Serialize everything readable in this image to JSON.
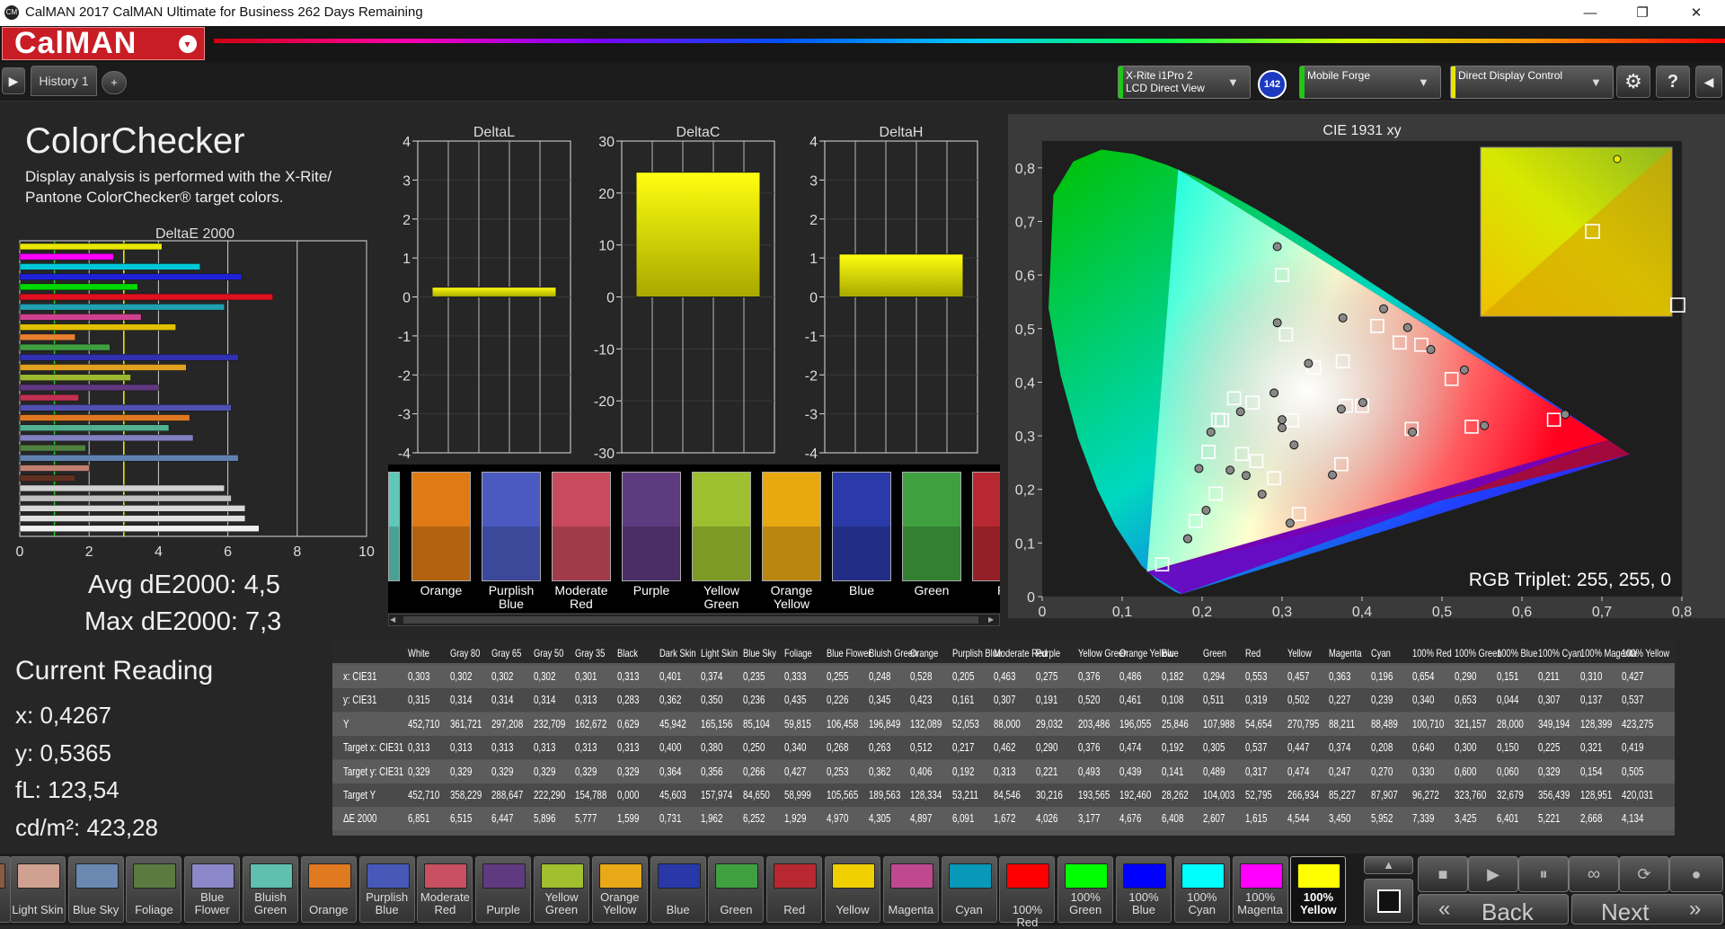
{
  "window": {
    "title": "CalMAN 2017 CalMAN Ultimate for Business 262 Days Remaining",
    "icon": "CM",
    "minimize": "—",
    "restore": "❐",
    "close": "✕"
  },
  "app": {
    "logo": "CalMAN",
    "logo_menu": "▾"
  },
  "toolbar": {
    "history_tab": "History 1",
    "add_tab": "+",
    "play": "▶",
    "devices": [
      {
        "line1": "X-Rite i1Pro 2",
        "line2": "LCD Direct View",
        "accent": "#1ec814"
      },
      {
        "line1": "Mobile Forge",
        "line2": "",
        "accent": "#1ec814"
      },
      {
        "line1": "Direct Display Control",
        "line2": "",
        "accent": "#e6e600"
      }
    ],
    "badge": "142",
    "settings": "⚙",
    "help": "?",
    "collapse": "◀"
  },
  "colors": {
    "accent": "#c81d25",
    "bar_yellow": "#ffff00"
  },
  "page": {
    "title": "ColorChecker",
    "subtitle_line1": "Display analysis is performed with the X-Rite/",
    "subtitle_line2": "Pantone ColorChecker® target colors.",
    "avg": "Avg dE2000: 4,5",
    "max": "Max dE2000: 7,3"
  },
  "current": {
    "title": "Current Reading",
    "x": "x: 0,4267",
    "y": "y: 0,5365",
    "fl": "fL: 123,54",
    "cdm2": "cd/m²: 423,28"
  },
  "chart_data": [
    {
      "type": "bar",
      "orientation": "horizontal",
      "title": "DeltaE 2000",
      "xlim": [
        0,
        10
      ],
      "xticks": [
        "0",
        "2",
        "4",
        "6",
        "8",
        "10"
      ],
      "reference_lines": [
        1,
        3
      ],
      "bars": [
        {
          "value": 4.1,
          "color": "#e8e800"
        },
        {
          "value": 2.7,
          "color": "#ff00ff"
        },
        {
          "value": 5.2,
          "color": "#00c8d8"
        },
        {
          "value": 6.4,
          "color": "#2020d8"
        },
        {
          "value": 3.4,
          "color": "#00d800"
        },
        {
          "value": 7.3,
          "color": "#e01020"
        },
        {
          "value": 5.9,
          "color": "#20a0b0"
        },
        {
          "value": 3.5,
          "color": "#d04090"
        },
        {
          "value": 4.5,
          "color": "#e0c000"
        },
        {
          "value": 1.6,
          "color": "#e88030"
        },
        {
          "value": 2.6,
          "color": "#40a040"
        },
        {
          "value": 6.3,
          "color": "#3030b0"
        },
        {
          "value": 4.8,
          "color": "#e0a020"
        },
        {
          "value": 3.2,
          "color": "#9ab830"
        },
        {
          "value": 4.0,
          "color": "#603880"
        },
        {
          "value": 1.7,
          "color": "#c03050"
        },
        {
          "value": 6.1,
          "color": "#5050b0"
        },
        {
          "value": 4.9,
          "color": "#e07820"
        },
        {
          "value": 4.3,
          "color": "#50b090"
        },
        {
          "value": 5.0,
          "color": "#8080c0"
        },
        {
          "value": 1.9,
          "color": "#508040"
        },
        {
          "value": 6.3,
          "color": "#6080b0"
        },
        {
          "value": 2.0,
          "color": "#c08070"
        },
        {
          "value": 1.6,
          "color": "#603020"
        },
        {
          "value": 5.9,
          "color": "#d0d0d0"
        },
        {
          "value": 6.1,
          "color": "#c0c0c0"
        },
        {
          "value": 6.5,
          "color": "#d8d8d8"
        },
        {
          "value": 6.5,
          "color": "#e0e0e0"
        },
        {
          "value": 6.9,
          "color": "#f0f0f0"
        }
      ]
    },
    {
      "type": "bar",
      "title": "DeltaL",
      "ylim": [
        -4,
        4
      ],
      "yticks": [
        "4",
        "3",
        "2",
        "1",
        "0",
        "-1",
        "-2",
        "-3",
        "-4"
      ],
      "value": 0.25
    },
    {
      "type": "bar",
      "title": "DeltaC",
      "ylim": [
        -30,
        30
      ],
      "yticks": [
        "30",
        "20",
        "10",
        "0",
        "-10",
        "-20",
        "-30"
      ],
      "value": 24
    },
    {
      "type": "bar",
      "title": "DeltaH",
      "ylim": [
        -4,
        4
      ],
      "yticks": [
        "4",
        "3",
        "2",
        "1",
        "0",
        "-1",
        "-2",
        "-3",
        "-4"
      ],
      "value": 1.1
    },
    {
      "type": "scatter",
      "title": "CIE 1931 xy",
      "xlim": [
        0,
        0.8
      ],
      "ylim": [
        0,
        0.85
      ],
      "xticks": [
        "0",
        "0,1",
        "0,2",
        "0,3",
        "0,4",
        "0,5",
        "0,6",
        "0,7",
        "0,8"
      ],
      "yticks": [
        "0",
        "0,1",
        "0,2",
        "0,3",
        "0,4",
        "0,5",
        "0,6",
        "0,7",
        "0,8"
      ],
      "gamut": {
        "r": [
          0.708,
          0.292
        ],
        "g": [
          0.17,
          0.797
        ],
        "b": [
          0.131,
          0.046
        ]
      },
      "targets": [
        [
          0.64,
          0.33
        ],
        [
          0.3,
          0.6
        ],
        [
          0.15,
          0.06
        ],
        [
          0.3127,
          0.329
        ],
        [
          0.419,
          0.505
        ],
        [
          0.225,
          0.329
        ],
        [
          0.321,
          0.154
        ],
        [
          0.4,
          0.356
        ],
        [
          0.38,
          0.356
        ],
        [
          0.25,
          0.266
        ],
        [
          0.34,
          0.427
        ],
        [
          0.268,
          0.253
        ],
        [
          0.263,
          0.362
        ],
        [
          0.512,
          0.406
        ],
        [
          0.217,
          0.192
        ],
        [
          0.462,
          0.313
        ],
        [
          0.29,
          0.221
        ],
        [
          0.376,
          0.439
        ],
        [
          0.474,
          0.47
        ],
        [
          0.192,
          0.141
        ],
        [
          0.305,
          0.489
        ],
        [
          0.537,
          0.317
        ],
        [
          0.447,
          0.474
        ],
        [
          0.374,
          0.247
        ],
        [
          0.208,
          0.27
        ],
        [
          0.22,
          0.33
        ],
        [
          0.24,
          0.37
        ]
      ],
      "measured": [
        [
          0.654,
          0.34
        ],
        [
          0.294,
          0.653
        ],
        [
          0.182,
          0.108
        ],
        [
          0.3,
          0.315
        ],
        [
          0.427,
          0.537
        ],
        [
          0.211,
          0.307
        ],
        [
          0.31,
          0.137
        ],
        [
          0.401,
          0.362
        ],
        [
          0.374,
          0.35
        ],
        [
          0.235,
          0.236
        ],
        [
          0.333,
          0.435
        ],
        [
          0.255,
          0.226
        ],
        [
          0.248,
          0.345
        ],
        [
          0.528,
          0.423
        ],
        [
          0.205,
          0.161
        ],
        [
          0.463,
          0.307
        ],
        [
          0.275,
          0.191
        ],
        [
          0.376,
          0.52
        ],
        [
          0.486,
          0.461
        ],
        [
          0.182,
          0.108
        ],
        [
          0.294,
          0.511
        ],
        [
          0.553,
          0.319
        ],
        [
          0.457,
          0.502
        ],
        [
          0.363,
          0.227
        ],
        [
          0.196,
          0.239
        ],
        [
          0.29,
          0.38
        ],
        [
          0.3,
          0.33
        ],
        [
          0.315,
          0.283
        ]
      ],
      "current": [
        0.4267,
        0.5365
      ],
      "rgb_triplet": "RGB Triplet: 255, 255, 0"
    }
  ],
  "swatches": [
    {
      "label": "",
      "color": "#5fc8b8"
    },
    {
      "label": "Orange",
      "color": "#e07a14"
    },
    {
      "label": "Purplish\nBlue",
      "color": "#4b5ac0"
    },
    {
      "label": "Moderate\nRed",
      "color": "#c84a5c"
    },
    {
      "label": "Purple",
      "color": "#5e3a7e"
    },
    {
      "label": "Yellow\nGreen",
      "color": "#9cc030"
    },
    {
      "label": "Orange\nYellow",
      "color": "#e8a810"
    },
    {
      "label": "Blue",
      "color": "#2a3aa8"
    },
    {
      "label": "Green",
      "color": "#40a040"
    },
    {
      "label": "R",
      "color": "#b82830"
    }
  ],
  "table": {
    "headers": [
      "White",
      "Gray 80",
      "Gray 65",
      "Gray 50",
      "Gray 35",
      "Black",
      "Dark Skin",
      "Light Skin",
      "Blue Sky",
      "Foliage",
      "Blue Flower",
      "Bluish Green",
      "Orange",
      "Purplish Blue",
      "Moderate Red",
      "Purple",
      "Yellow Green",
      "Orange Yellow",
      "Blue",
      "Green",
      "Red",
      "Yellow",
      "Magenta",
      "Cyan",
      "100% Red",
      "100% Green",
      "100% Blue",
      "100% Cyan",
      "100% Magenta",
      "100% Yellow"
    ],
    "rows": [
      {
        "label": "x: CIE31",
        "values": [
          "0,303",
          "0,302",
          "0,302",
          "0,302",
          "0,301",
          "0,313",
          "0,401",
          "0,374",
          "0,235",
          "0,333",
          "0,255",
          "0,248",
          "0,528",
          "0,205",
          "0,463",
          "0,275",
          "0,376",
          "0,486",
          "0,182",
          "0,294",
          "0,553",
          "0,457",
          "0,363",
          "0,196",
          "0,654",
          "0,290",
          "0,151",
          "0,211",
          "0,310",
          "0,427"
        ]
      },
      {
        "label": "y: CIE31",
        "values": [
          "0,315",
          "0,314",
          "0,314",
          "0,314",
          "0,313",
          "0,283",
          "0,362",
          "0,350",
          "0,236",
          "0,435",
          "0,226",
          "0,345",
          "0,423",
          "0,161",
          "0,307",
          "0,191",
          "0,520",
          "0,461",
          "0,108",
          "0,511",
          "0,319",
          "0,502",
          "0,227",
          "0,239",
          "0,340",
          "0,653",
          "0,044",
          "0,307",
          "0,137",
          "0,537"
        ]
      },
      {
        "label": "Y",
        "values": [
          "452,710",
          "361,721",
          "297,208",
          "232,709",
          "162,672",
          "0,629",
          "45,942",
          "165,156",
          "85,104",
          "59,815",
          "106,458",
          "196,849",
          "132,089",
          "52,053",
          "88,000",
          "29,032",
          "203,486",
          "196,055",
          "25,846",
          "107,988",
          "54,654",
          "270,795",
          "88,211",
          "88,489",
          "100,710",
          "321,157",
          "28,000",
          "349,194",
          "128,399",
          "423,275"
        ]
      },
      {
        "label": "Target x: CIE31",
        "values": [
          "0,313",
          "0,313",
          "0,313",
          "0,313",
          "0,313",
          "0,313",
          "0,400",
          "0,380",
          "0,250",
          "0,340",
          "0,268",
          "0,263",
          "0,512",
          "0,217",
          "0,462",
          "0,290",
          "0,376",
          "0,474",
          "0,192",
          "0,305",
          "0,537",
          "0,447",
          "0,374",
          "0,208",
          "0,640",
          "0,300",
          "0,150",
          "0,225",
          "0,321",
          "0,419"
        ]
      },
      {
        "label": "Target y: CIE31",
        "values": [
          "0,329",
          "0,329",
          "0,329",
          "0,329",
          "0,329",
          "0,329",
          "0,364",
          "0,356",
          "0,266",
          "0,427",
          "0,253",
          "0,362",
          "0,406",
          "0,192",
          "0,313",
          "0,221",
          "0,493",
          "0,439",
          "0,141",
          "0,489",
          "0,317",
          "0,474",
          "0,247",
          "0,270",
          "0,330",
          "0,600",
          "0,060",
          "0,329",
          "0,154",
          "0,505"
        ]
      },
      {
        "label": "Target Y",
        "values": [
          "452,710",
          "358,229",
          "288,647",
          "222,290",
          "154,788",
          "0,000",
          "45,603",
          "157,974",
          "84,650",
          "58,999",
          "105,565",
          "189,563",
          "128,334",
          "53,211",
          "84,546",
          "30,216",
          "193,565",
          "192,460",
          "28,262",
          "104,003",
          "52,795",
          "266,934",
          "85,227",
          "87,907",
          "96,272",
          "323,760",
          "32,679",
          "356,439",
          "128,951",
          "420,031"
        ]
      },
      {
        "label": "ΔE 2000",
        "values": [
          "6,851",
          "6,515",
          "6,447",
          "5,896",
          "5,777",
          "1,599",
          "0,731",
          "1,962",
          "6,252",
          "1,929",
          "4,970",
          "4,305",
          "4,897",
          "6,091",
          "1,672",
          "4,026",
          "3,177",
          "4,676",
          "6,408",
          "2,607",
          "1,615",
          "4,544",
          "3,450",
          "5,952",
          "7,339",
          "3,425",
          "6,401",
          "5,221",
          "2,668",
          "4,134"
        ]
      }
    ]
  },
  "bottom_swatches": [
    {
      "label": "kin",
      "color": "#8a5a44"
    },
    {
      "label": "Light Skin",
      "color": "#d0a090"
    },
    {
      "label": "Blue Sky",
      "color": "#6a88b0"
    },
    {
      "label": "Foliage",
      "color": "#5a7a40"
    },
    {
      "label": "Blue\nFlower",
      "color": "#8a88c8"
    },
    {
      "label": "Bluish\nGreen",
      "color": "#60c0b0"
    },
    {
      "label": "Orange",
      "color": "#e07a20"
    },
    {
      "label": "Purplish\nBlue",
      "color": "#4858b8"
    },
    {
      "label": "Moderate\nRed",
      "color": "#c85060"
    },
    {
      "label": "Purple",
      "color": "#603a80"
    },
    {
      "label": "Yellow\nGreen",
      "color": "#a0c030"
    },
    {
      "label": "Orange\nYellow",
      "color": "#e8a818"
    },
    {
      "label": "Blue",
      "color": "#2838a8"
    },
    {
      "label": "Green",
      "color": "#40a040"
    },
    {
      "label": "Red",
      "color": "#b82830"
    },
    {
      "label": "Yellow",
      "color": "#f0d000"
    },
    {
      "label": "Magenta",
      "color": "#c04890"
    },
    {
      "label": "Cyan",
      "color": "#0898b8"
    },
    {
      "label": "100% Red",
      "color": "#ff0000"
    },
    {
      "label": "100%\nGreen",
      "color": "#00ff00"
    },
    {
      "label": "100%\nBlue",
      "color": "#0000ff"
    },
    {
      "label": "100%\nCyan",
      "color": "#00ffff"
    },
    {
      "label": "100%\nMagenta",
      "color": "#ff00ff"
    },
    {
      "label": "100%\nYellow",
      "color": "#ffff00"
    }
  ],
  "nav": {
    "back": "Back",
    "next": "Next",
    "back_arrow": "«",
    "next_arrow": "»",
    "stop": "■",
    "play": "▶",
    "loop": "∞",
    "up": "▲",
    "refresh": "⟳"
  }
}
